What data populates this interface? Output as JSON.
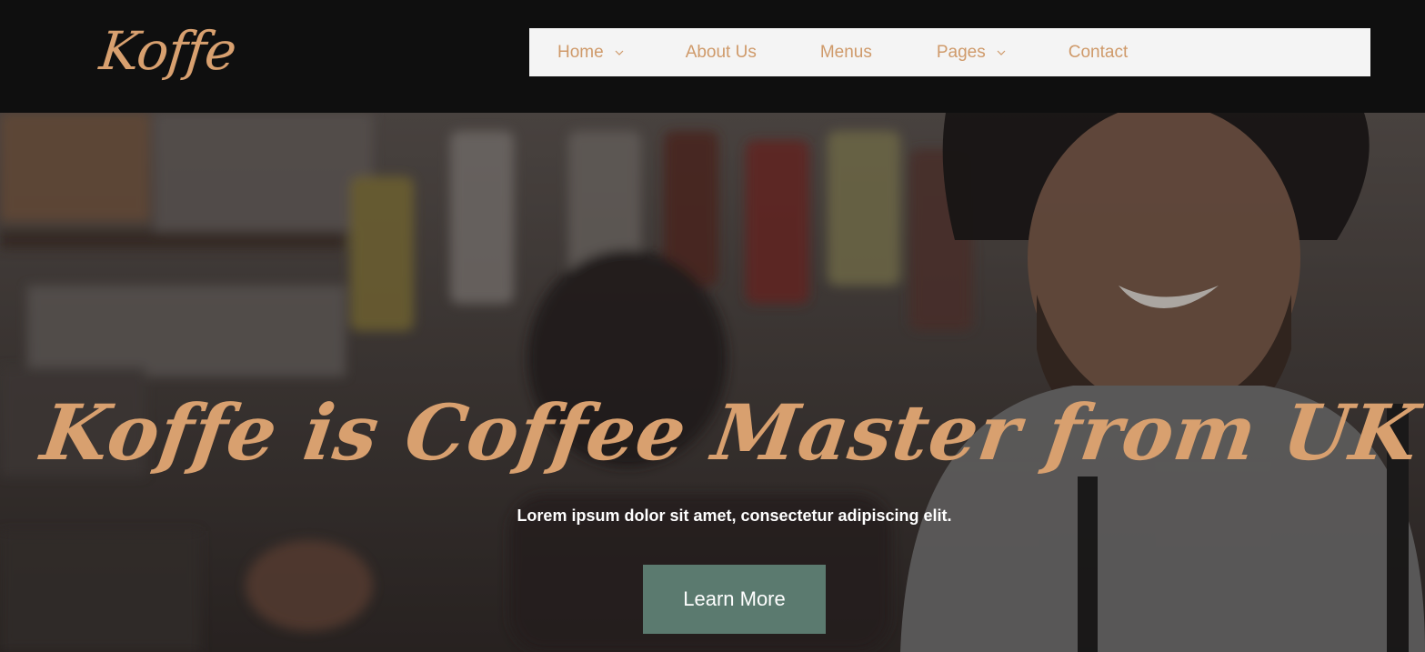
{
  "brand": {
    "logo_text": "Koffe",
    "accent_color": "#d8a06f"
  },
  "nav": {
    "items": [
      {
        "label": "Home",
        "has_dropdown": true
      },
      {
        "label": "About Us",
        "has_dropdown": false
      },
      {
        "label": "Menus",
        "has_dropdown": false
      },
      {
        "label": "Pages",
        "has_dropdown": true
      },
      {
        "label": "Contact",
        "has_dropdown": false
      }
    ],
    "dropdown_icon": "chevron-down-icon"
  },
  "hero": {
    "title": "Koffe is Coffee Master from UK",
    "subtitle": "Lorem ipsum dolor sit amet, consectetur adipiscing elit.",
    "cta_label": "Learn More",
    "cta_color": "#5b7a6f"
  }
}
